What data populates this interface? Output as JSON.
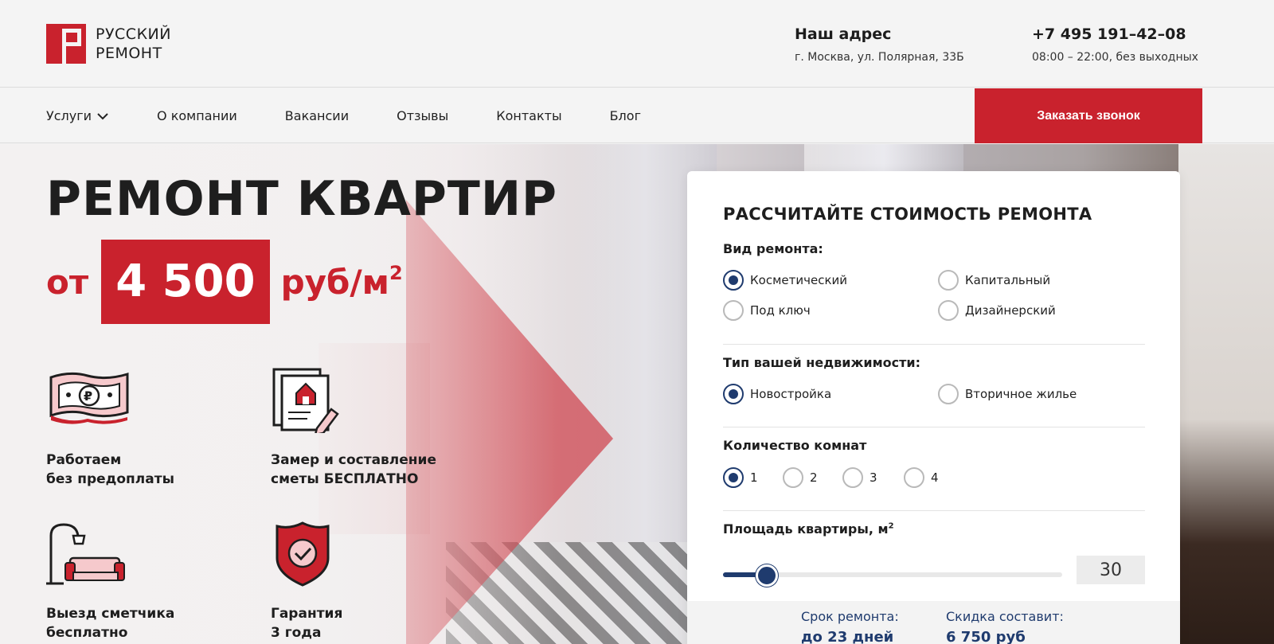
{
  "brand": {
    "name_line1": "РУССКИЙ",
    "name_line2": "РЕМОНТ",
    "accent": "#c9222d",
    "navy": "#1f3b6e"
  },
  "header": {
    "address_title": "Наш адрес",
    "address": "г. Москва, ул. Полярная, 33Б",
    "phone": "+7 495 191–42–08",
    "hours": "08:00 – 22:00, без выходных"
  },
  "nav": {
    "items": [
      "Услуги",
      "О компании",
      "Вакансии",
      "Отзывы",
      "Контакты",
      "Блог"
    ],
    "cta": "Заказать звонок"
  },
  "hero": {
    "title": "РЕМОНТ КВАРТИР",
    "price_from": "от",
    "price": "4 500",
    "price_unit": "руб/м",
    "price_unit_sup": "2"
  },
  "features": [
    {
      "icon": "money-icon",
      "text": "Работаем\nбез предоплаты"
    },
    {
      "icon": "estimate-document-icon",
      "text": "Замер и составление\nсметы БЕСПЛАТНО"
    },
    {
      "icon": "lamp-sofa-icon",
      "text": "Выезд сметчика\nбесплатно"
    },
    {
      "icon": "shield-check-icon",
      "text": "Гарантия\n3 года"
    }
  ],
  "calculator": {
    "title": "РАССЧИТАЙТЕ СТОИМОСТЬ РЕМОНТА",
    "repair_type_label": "Вид ремонта:",
    "repair_types": [
      "Косметический",
      "Капитальный",
      "Под ключ",
      "Дизайнерский"
    ],
    "repair_type_selected": "Косметический",
    "property_label": "Тип вашей недвижимости:",
    "property_types": [
      "Новостройка",
      "Вторичное жилье"
    ],
    "property_selected": "Новостройка",
    "rooms_label": "Количество комнат",
    "rooms": [
      "1",
      "2",
      "3",
      "4"
    ],
    "rooms_selected": "1",
    "area_label": "Площадь квартиры, м",
    "area_label_sup": "2",
    "area_value": "30",
    "area_slider_fraction": 0.13,
    "term_label": "Срок ремонта:",
    "term_value": "до 23 дней",
    "discount_label": "Скидка составит:",
    "discount_value": "6 750 руб"
  }
}
